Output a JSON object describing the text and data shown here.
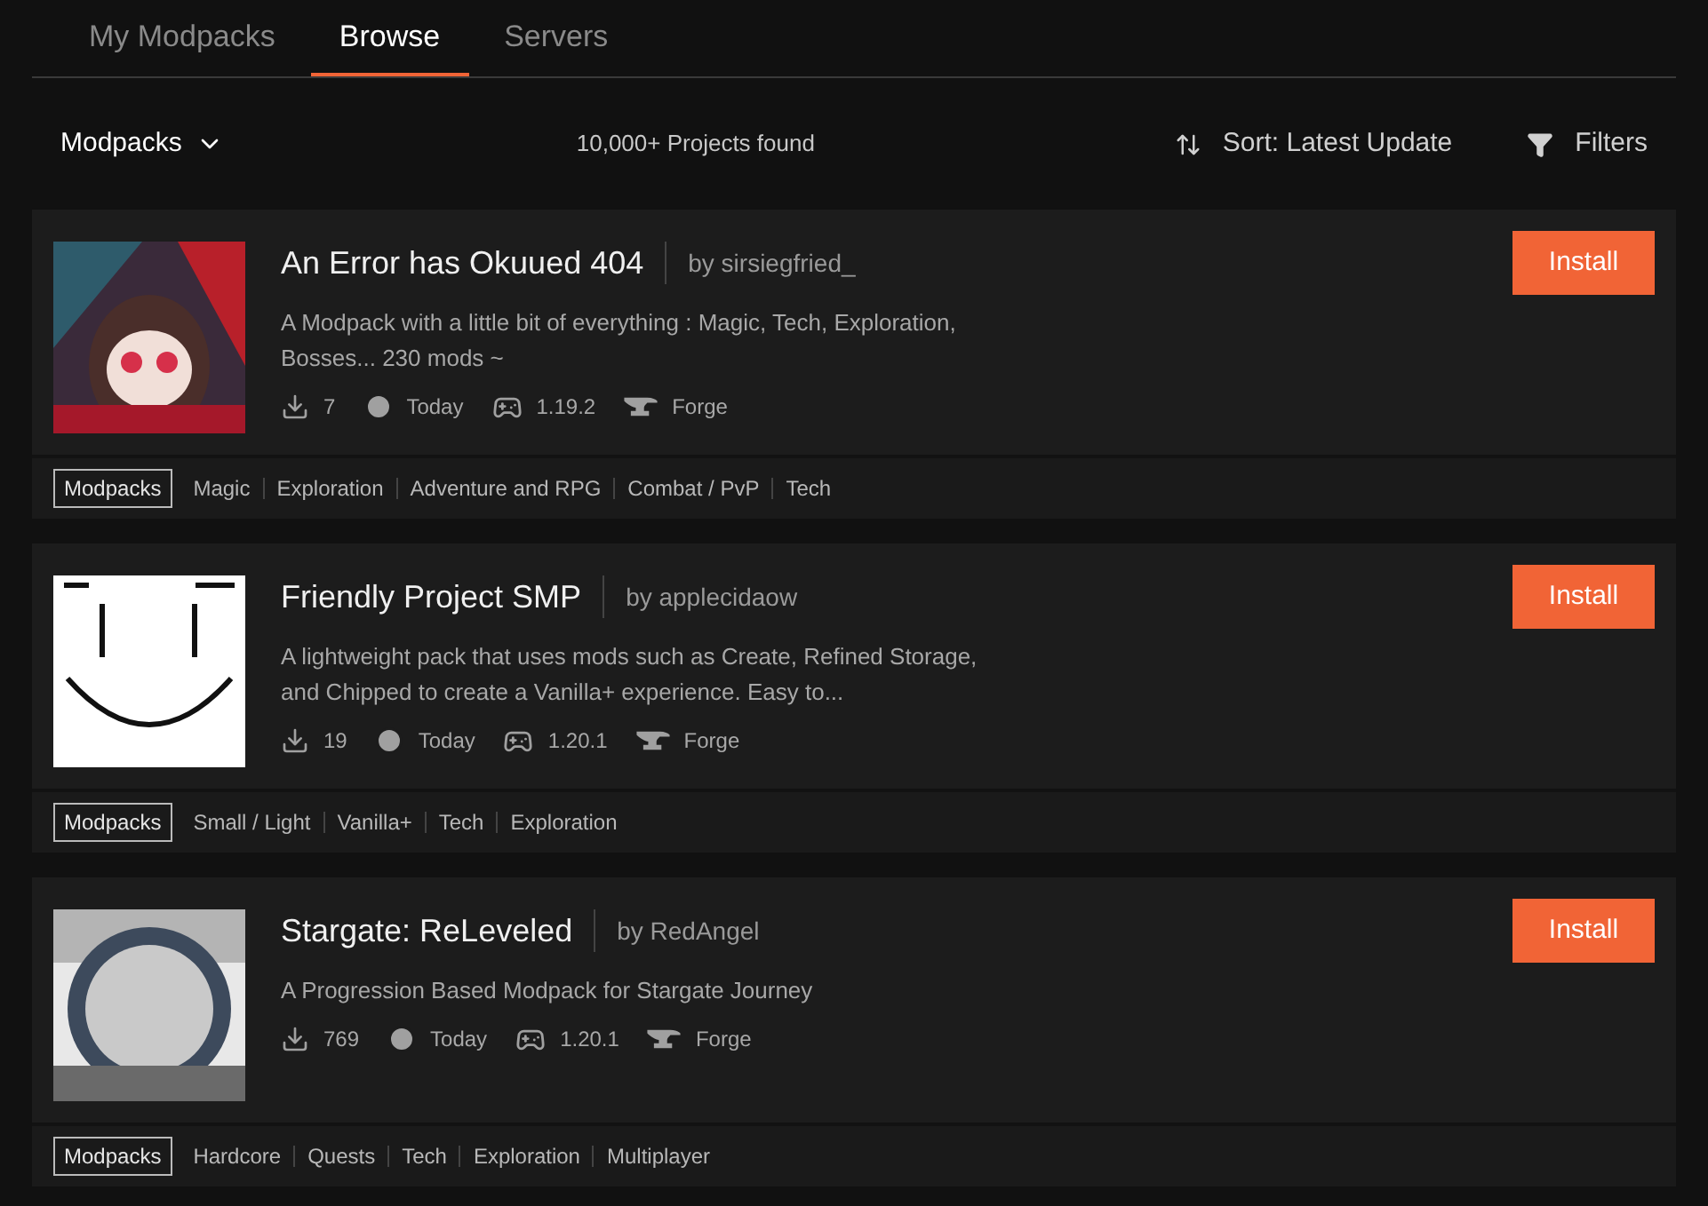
{
  "tabs": [
    {
      "label": "My Modpacks",
      "selected": false
    },
    {
      "label": "Browse",
      "selected": true
    },
    {
      "label": "Servers",
      "selected": false
    }
  ],
  "toolbar": {
    "category": "Modpacks",
    "results": "10,000+ Projects found",
    "sort": "Sort: Latest Update",
    "filters": "Filters"
  },
  "projects": [
    {
      "title": "An Error has Okuued 404",
      "author": "by sirsiegfried_",
      "description": "A Modpack with a little bit of everything : Magic, Tech, Exploration, Bosses... 230 mods ~",
      "downloads": "7",
      "updated": "Today",
      "version": "1.19.2",
      "loader": "Forge",
      "button": "Install",
      "tags": [
        {
          "label": "Modpacks",
          "kind": "category"
        },
        {
          "label": "Magic",
          "kind": "tag"
        },
        {
          "label": "Exploration",
          "kind": "tag"
        },
        {
          "label": "Adventure and RPG",
          "kind": "tag"
        },
        {
          "label": "Combat / PvP",
          "kind": "tag"
        },
        {
          "label": "Tech",
          "kind": "tag"
        }
      ]
    },
    {
      "title": "Friendly Project SMP",
      "author": "by applecidaow",
      "description": "A lightweight pack that uses mods such as Create, Refined Storage, and Chipped to create a Vanilla+ experience. Easy to...",
      "downloads": "19",
      "updated": "Today",
      "version": "1.20.1",
      "loader": "Forge",
      "button": "Install",
      "tags": [
        {
          "label": "Modpacks",
          "kind": "category"
        },
        {
          "label": "Small / Light",
          "kind": "tag"
        },
        {
          "label": "Vanilla+",
          "kind": "tag"
        },
        {
          "label": "Tech",
          "kind": "tag"
        },
        {
          "label": "Exploration",
          "kind": "tag"
        }
      ]
    },
    {
      "title": "Stargate: ReLeveled",
      "author": "by RedAngel",
      "description": "A Progression Based Modpack for Stargate Journey",
      "downloads": "769",
      "updated": "Today",
      "version": "1.20.1",
      "loader": "Forge",
      "button": "Install",
      "tags": [
        {
          "label": "Modpacks",
          "kind": "category"
        },
        {
          "label": "Hardcore",
          "kind": "tag"
        },
        {
          "label": "Quests",
          "kind": "tag"
        },
        {
          "label": "Tech",
          "kind": "tag"
        },
        {
          "label": "Exploration",
          "kind": "tag"
        },
        {
          "label": "Multiplayer",
          "kind": "tag"
        }
      ]
    }
  ]
}
